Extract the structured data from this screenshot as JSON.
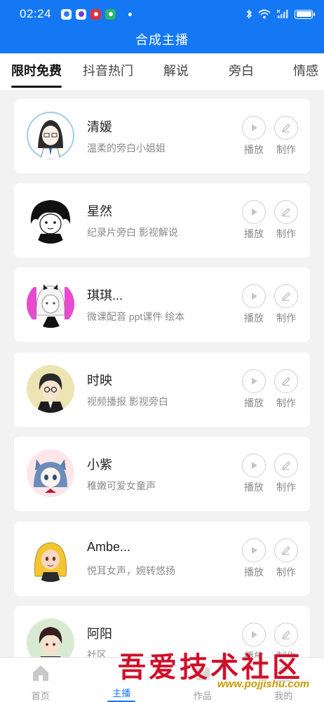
{
  "status_bar": {
    "time": "02:24"
  },
  "header": {
    "title": "合成主播"
  },
  "tabs": [
    {
      "label": "限时免费"
    },
    {
      "label": "抖音热门"
    },
    {
      "label": "解说"
    },
    {
      "label": "旁白"
    },
    {
      "label": "情感"
    }
  ],
  "action_labels": {
    "play": "播放",
    "edit": "制作"
  },
  "voices": [
    {
      "name": "清媛",
      "desc": "温柔的旁白小姐姐"
    },
    {
      "name": "星然",
      "desc": "纪录片旁白  影视解说"
    },
    {
      "name": "琪琪...",
      "desc": "微课配音 ppt课件 绘本"
    },
    {
      "name": "时映",
      "desc": "视频播报  影视旁白"
    },
    {
      "name": "小紫",
      "desc": "稚嫩可爱女童声"
    },
    {
      "name": "Ambe...",
      "desc": "悦耳女声，婉转悠扬"
    },
    {
      "name": "阿阳",
      "desc": "社区"
    }
  ],
  "bottom_nav": [
    {
      "label": "首页"
    },
    {
      "label": "主播"
    },
    {
      "label": "作品"
    },
    {
      "label": "我的"
    }
  ],
  "watermark": {
    "text": "吾爱技术社区",
    "url": "www.pojjishu.com"
  },
  "colors": {
    "primary": "#1478f5",
    "background": "#f2f2f2",
    "watermark": "#d0102a"
  }
}
